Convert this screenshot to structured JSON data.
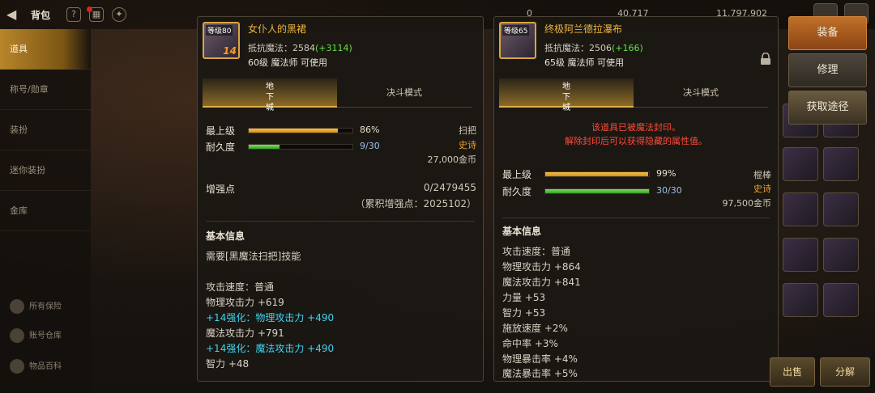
{
  "topbar": {
    "title": "背包",
    "currency_1": "0",
    "currency_2": "40,717",
    "currency_3": "11,797,902"
  },
  "sidebar": {
    "items": [
      {
        "label": "道具"
      },
      {
        "label": "称号/勋章"
      },
      {
        "label": "装扮"
      },
      {
        "label": "迷你装扮"
      },
      {
        "label": "金库"
      }
    ],
    "bottom": [
      {
        "label": "所有保险"
      },
      {
        "label": "账号仓库"
      },
      {
        "label": "物品百科"
      }
    ]
  },
  "actions": {
    "equip": "装备",
    "repair": "修理",
    "source": "获取途径",
    "sell": "出售",
    "disassemble": "分解"
  },
  "left_item": {
    "icon": "broom-weapon-icon",
    "icon_tag": "等级80",
    "enhance": "14",
    "name": "女仆人的黑裙",
    "resist_label": "抵抗魔法：",
    "resist_value": "2584",
    "resist_bonus": "(+3114)",
    "requirement": "60级 魔法师 可使用",
    "tabs": [
      "地下城",
      "决斗模式"
    ],
    "stats": {
      "max_label": "最上级",
      "max_pct": 86,
      "max_text": "86%",
      "dur_label": "耐久度",
      "dur_current": 9,
      "dur_max": 30,
      "dur_text": "9/30",
      "type": "扫把",
      "rarity": "史诗",
      "price": "27,000金币"
    },
    "enhance_label": "增强点",
    "enhance_value": "0/2479455",
    "enhance_cumulative": "（累积增强点：2025102）",
    "basic_title": "基本信息",
    "lines": [
      {
        "text": "需要[黑魔法扫把]技能",
        "style": "normal"
      },
      {
        "text": "攻击速度：普通",
        "style": "normal"
      },
      {
        "text": "物理攻击力 +619",
        "style": "normal"
      },
      {
        "text": "+14强化：物理攻击力 +490",
        "style": "cyan"
      },
      {
        "text": "魔法攻击力 +791",
        "style": "normal"
      },
      {
        "text": "+14强化：魔法攻击力 +490",
        "style": "cyan"
      },
      {
        "text": "智力 +48",
        "style": "normal"
      }
    ]
  },
  "right_item": {
    "icon": "staff-weapon-icon",
    "icon_tag": "等级65",
    "name": "终极阿兰德拉瀑布",
    "resist_label": "抵抗魔法：",
    "resist_value": "2506",
    "resist_bonus": "(+166)",
    "requirement": "65级 魔法师 可使用",
    "tabs": [
      "地下城",
      "决斗模式"
    ],
    "sealed_1": "该道具已被魔法封印。",
    "sealed_2": "解除封印后可以获得隐藏的属性值。",
    "stats": {
      "max_label": "最上级",
      "max_pct": 99,
      "max_text": "99%",
      "dur_label": "耐久度",
      "dur_current": 30,
      "dur_max": 30,
      "dur_text": "30/30",
      "type": "棍棒",
      "rarity": "史诗",
      "price": "97,500金币"
    },
    "basic_title": "基本信息",
    "lines": [
      {
        "text": "攻击速度：普通",
        "style": "normal"
      },
      {
        "text": "物理攻击力 +864",
        "style": "normal"
      },
      {
        "text": "魔法攻击力 +841",
        "style": "normal"
      },
      {
        "text": "力量 +53",
        "style": "normal"
      },
      {
        "text": "智力 +53",
        "style": "normal"
      },
      {
        "text": "施放速度 +2%",
        "style": "normal"
      },
      {
        "text": "命中率 +3%",
        "style": "normal"
      },
      {
        "text": "物理暴击率 +4%",
        "style": "normal"
      },
      {
        "text": "魔法暴击率 +5%",
        "style": "normal"
      }
    ]
  },
  "colors": {
    "accent_gold": "#e0b04a",
    "name_orange": "#f0b43c",
    "bonus_green": "#66e04a",
    "enhance_cyan": "#3fd4f0",
    "epic_orange": "#e9a02a",
    "sealed_red": "#ff4a3a"
  }
}
